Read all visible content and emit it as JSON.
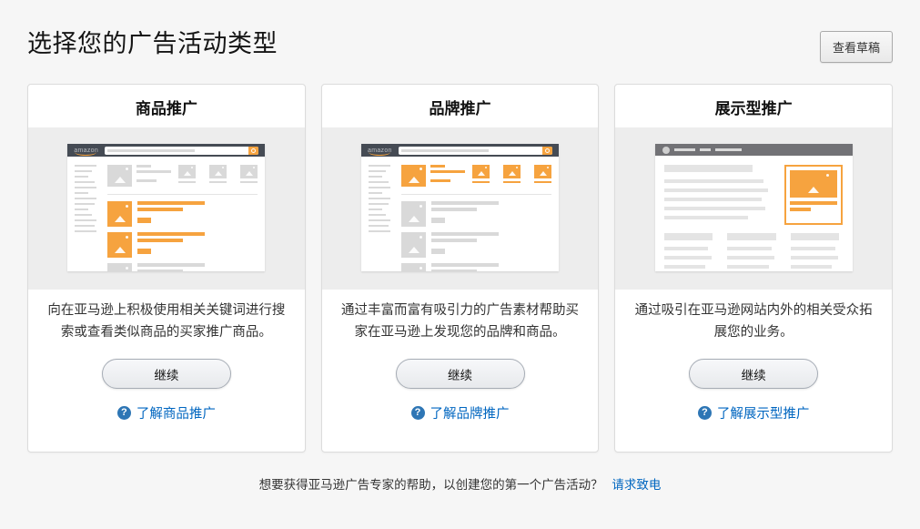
{
  "header": {
    "title": "选择您的广告活动类型",
    "view_drafts_label": "查看草稿"
  },
  "cards": [
    {
      "title": "商品推广",
      "description": "向在亚马逊上积极使用相关关键词进行搜索或查看类似商品的买家推广商品。",
      "continue_label": "继续",
      "learn_label": "了解商品推广",
      "help_icon": "?",
      "illustration": "amazon-search-results-with-sponsored-product-listings-highlighted"
    },
    {
      "title": "品牌推广",
      "description": "通过丰富而富有吸引力的广告素材帮助买家在亚马逊上发现您的品牌和商品。",
      "continue_label": "继续",
      "learn_label": "了解品牌推广",
      "help_icon": "?",
      "illustration": "amazon-search-results-with-brand-banner-highlighted"
    },
    {
      "title": "展示型推广",
      "description": "通过吸引在亚马逊网站内外的相关受众拓展您的业务。",
      "continue_label": "继续",
      "learn_label": "了解展示型推广",
      "help_icon": "?",
      "illustration": "third-party-website-with-display-ad-highlighted"
    }
  ],
  "illustration_labels": {
    "amazon_logo": "amazon"
  },
  "footer": {
    "text": "想要获得亚马逊广告专家的帮助，以创建您的第一个广告活动？",
    "link_label": "请求致电"
  },
  "colors": {
    "accent_orange": "#f6a33f",
    "link_blue": "#0066c0",
    "help_icon_blue": "#2e76b5",
    "header_dark": "#454b54",
    "site_header_gray": "#727276",
    "page_background": "#f6f6f6"
  }
}
